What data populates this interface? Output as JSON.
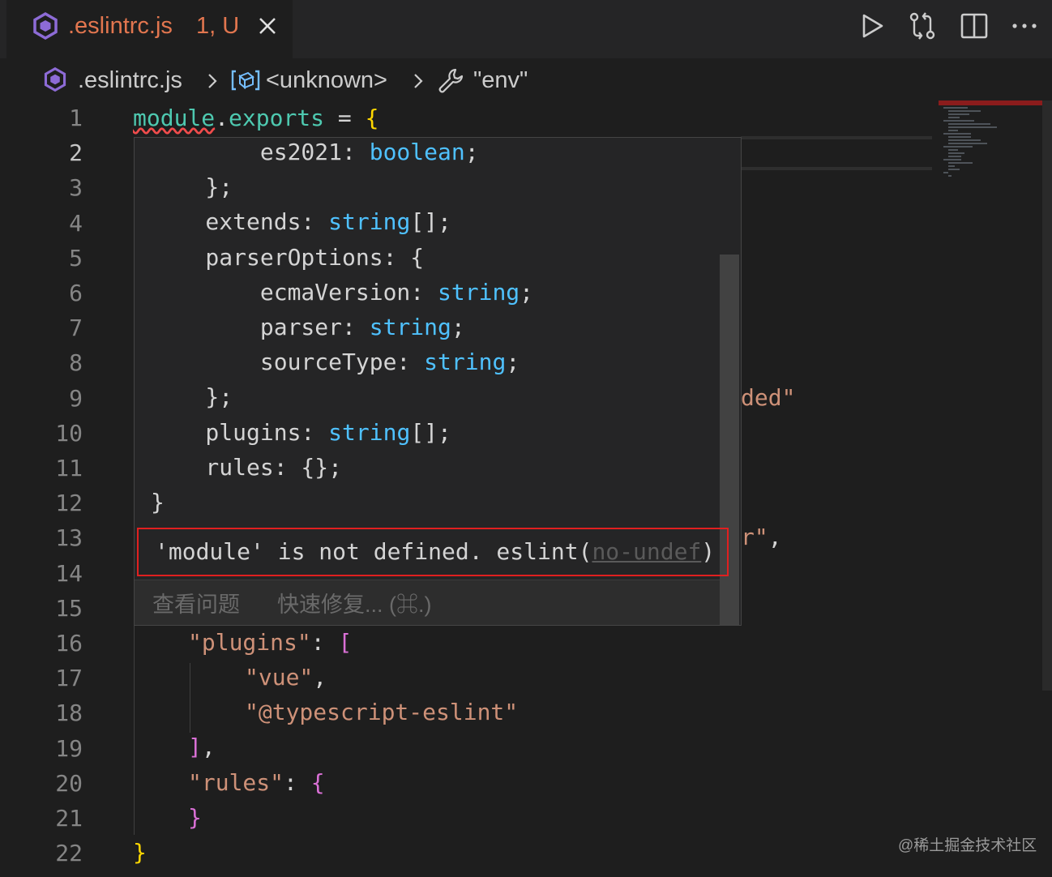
{
  "tab": {
    "filename": ".eslintrc.js",
    "status": "1, U",
    "icon": "eslint-icon",
    "close_icon": "close-icon",
    "color": "#e2764f"
  },
  "toolbar": {
    "run_icon": "play-icon",
    "compare_icon": "git-compare-icon",
    "split_icon": "split-editor-icon",
    "more_icon": "more-icon"
  },
  "breadcrumb": {
    "file": ".eslintrc.js",
    "symbol": "<unknown>",
    "property": "\"env\""
  },
  "lines": [
    "1",
    "2",
    "3",
    "4",
    "5",
    "6",
    "7",
    "8",
    "9",
    "10",
    "11",
    "12",
    "13",
    "14",
    "15",
    "16",
    "17",
    "18",
    "19",
    "20",
    "21",
    "22"
  ],
  "code": {
    "l1_module": "module",
    "l1_dot": ".",
    "l1_exports": "exports",
    "l1_eq": " = ",
    "l1_brace": "{",
    "l9_tail": "ded\"",
    "l13_tail_a": "r\"",
    "l13_tail_b": ",",
    "l16_key": "\"plugins\"",
    "l16_colon": ": ",
    "l16_open": "[",
    "l17": "\"vue\"",
    "l17_comma": ",",
    "l18": "\"@typescript-eslint\"",
    "l19_close": "]",
    "l19_comma": ",",
    "l20_key": "\"rules\"",
    "l20_colon": ": ",
    "l20_open": "{",
    "l21_close": "}",
    "l22_close": "}"
  },
  "hover": {
    "lines": [
      {
        "pre": "        es2021: ",
        "type": "boolean",
        "post": ";"
      },
      {
        "pre": "    };",
        "type": "",
        "post": ""
      },
      {
        "pre": "    extends: ",
        "type": "string",
        "post": "[];"
      },
      {
        "pre": "    parserOptions: {",
        "type": "",
        "post": ""
      },
      {
        "pre": "        ecmaVersion: ",
        "type": "string",
        "post": ";"
      },
      {
        "pre": "        parser: ",
        "type": "string",
        "post": ";"
      },
      {
        "pre": "        sourceType: ",
        "type": "string",
        "post": ";"
      },
      {
        "pre": "    };",
        "type": "",
        "post": ""
      },
      {
        "pre": "    plugins: ",
        "type": "string",
        "post": "[];"
      },
      {
        "pre": "    rules: {};",
        "type": "",
        "post": ""
      },
      {
        "pre": "}",
        "type": "",
        "post": ""
      }
    ],
    "diagnostic": "'module' is not defined. eslint(",
    "rule": "no-undef",
    "diagnostic_end": ")",
    "view_problem": "查看问题",
    "quick_fix": "快速修复... (⌘.)"
  },
  "watermark": "@稀土掘金技术社区"
}
